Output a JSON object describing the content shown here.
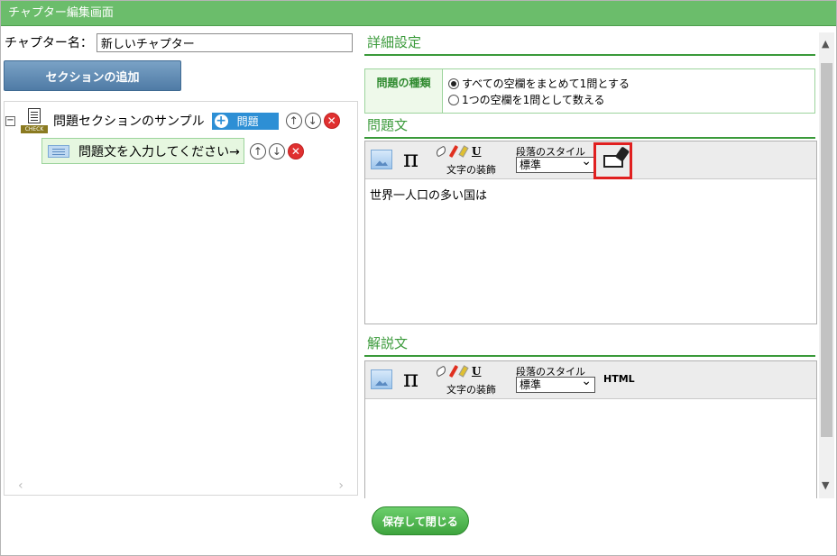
{
  "window": {
    "title": "チャプター編集画面"
  },
  "chapter": {
    "label": "チャプター名：",
    "name_value": "新しいチャプター"
  },
  "left": {
    "add_section_label": "セクションの追加",
    "tree": {
      "section_title": "問題セクションのサンプル",
      "check_tag": "CHECK",
      "add_question_label": "問題",
      "question_text": "問題文を入力してください→"
    }
  },
  "right": {
    "detail_header": "詳細設定",
    "qtype": {
      "label": "問題の種類",
      "options": [
        "すべての空欄をまとめて1問とする",
        "1つの空欄を1問として数える"
      ],
      "selected_index": 0
    },
    "question_header": "問題文",
    "explanation_header": "解説文",
    "editor": {
      "deco_label": "文字の装飾",
      "style_label": "段落のスタイル",
      "style_value": "標準",
      "underline_label": "U",
      "pi_label": "π",
      "html_label": "HTML"
    },
    "question_body": "世界一人口の多い国は",
    "explanation_body": ""
  },
  "footer": {
    "save_label": "保存して閉じる"
  }
}
